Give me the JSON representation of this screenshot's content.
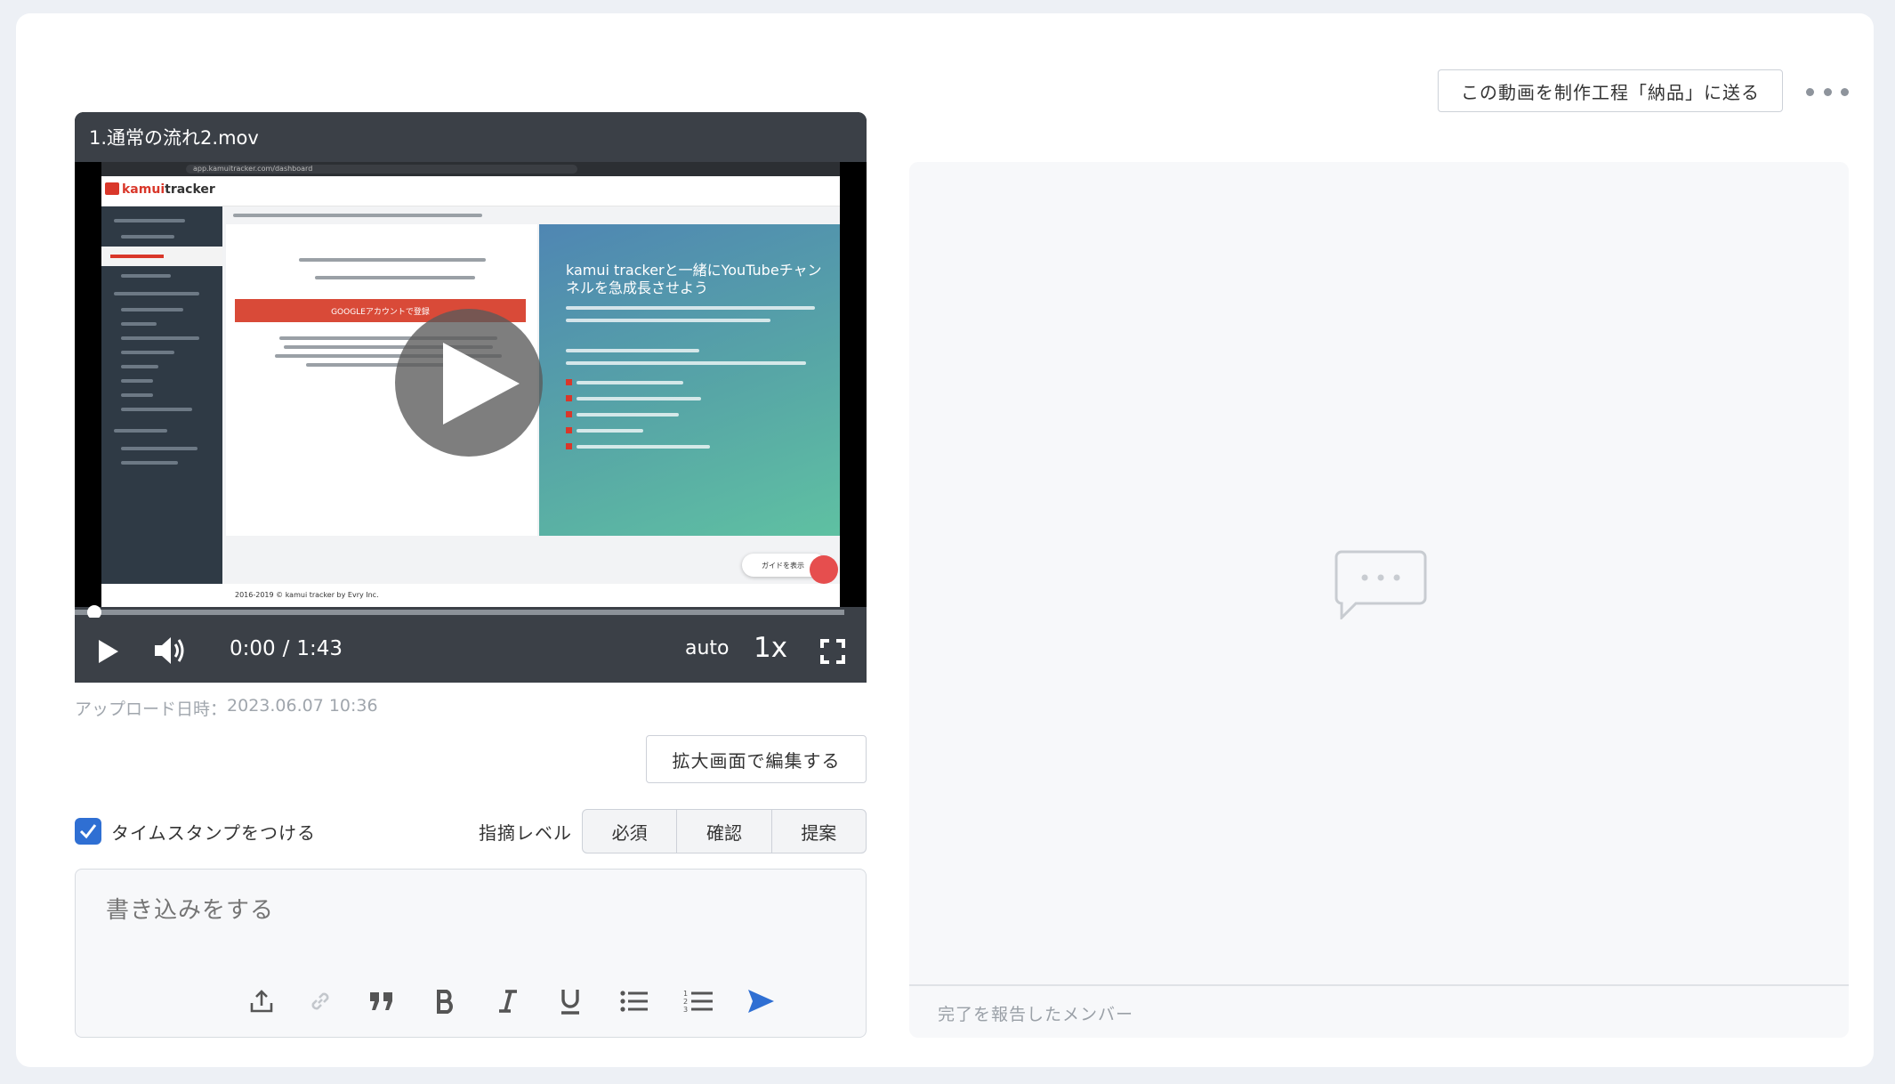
{
  "header": {
    "deliver_button": "この動画を制作工程「納品」に送る",
    "more_icon": "more-horizontal-icon"
  },
  "player": {
    "title": "1.通常の流れ2.mov",
    "thumbnail": {
      "url": "app.kamuitracker.com/dashboard",
      "logo_prefix": "kamui",
      "logo_suffix": "tracker",
      "google_button": "GOOGLEアカウントで登録",
      "headline": "kamui trackerと一緒にYouTubeチャンネルを急成長させよう",
      "guide_button": "ガイドを表示",
      "footer": "2016-2019 © kamui tracker by Evry Inc."
    },
    "current_time": "0:00",
    "separator": "/",
    "duration": "1:43",
    "quality": "auto",
    "rate": "1x",
    "progress_fraction": 0.0
  },
  "upload": {
    "label": "アップロード日時：",
    "datetime": "2023.06.07 10:36"
  },
  "expand_button": "拡大画面で編集する",
  "timestamp": {
    "label": "タイムスタンプをつける",
    "checked": true
  },
  "level": {
    "label": "指摘レベル",
    "options": [
      "必須",
      "確認",
      "提案"
    ]
  },
  "editor": {
    "placeholder": "書き込みをする",
    "tools": [
      "upload-icon",
      "link-icon",
      "quote-icon",
      "bold-icon",
      "italic-icon",
      "underline-icon",
      "bullet-list-icon",
      "numbered-list-icon",
      "send-icon"
    ]
  },
  "comments": {
    "empty_icon": "comment-bubble-icon",
    "members_label": "完了を報告したメンバー"
  },
  "colors": {
    "accent": "#2f6fd3",
    "player_bar": "#3b4047",
    "panel_bg": "#f7f8fa"
  }
}
